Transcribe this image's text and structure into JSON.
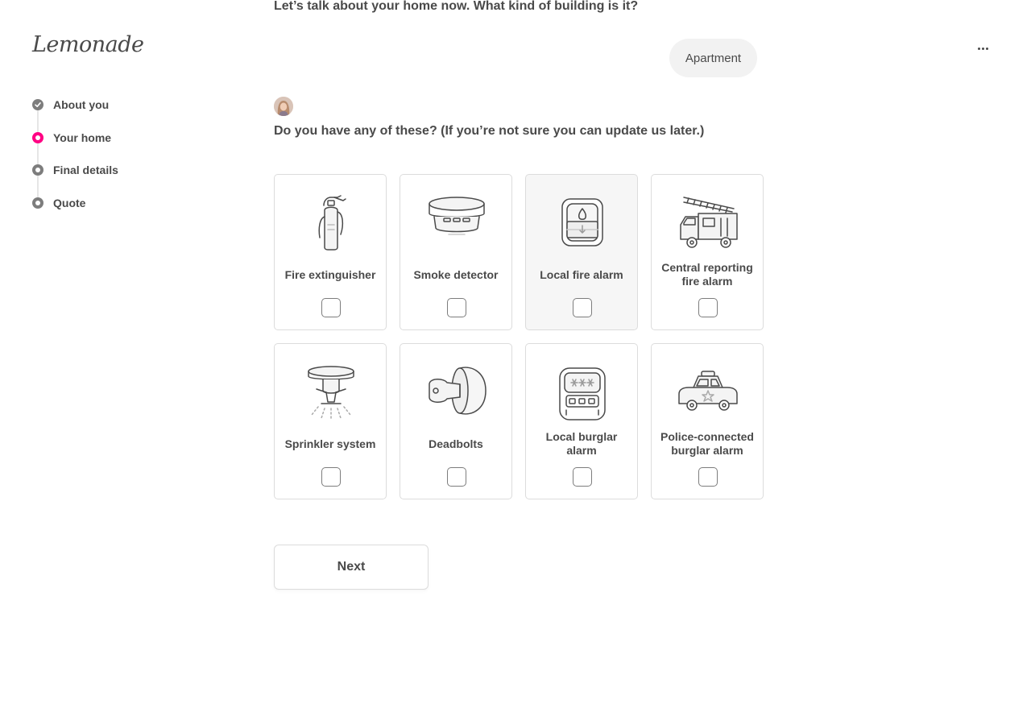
{
  "brand": {
    "logo_text": "Lemonade"
  },
  "progress": {
    "steps": [
      {
        "label": "About you",
        "state": "done"
      },
      {
        "label": "Your home",
        "state": "active"
      },
      {
        "label": "Final details",
        "state": "pending"
      },
      {
        "label": "Quote",
        "state": "pending"
      }
    ],
    "active_color": "#ff0083"
  },
  "conversation": {
    "previous_question": "Let’s talk about your home now. What kind of building is it?",
    "previous_answer": "Apartment",
    "question": "Do you have any of these? (If you’re not sure you can update us later.)"
  },
  "options": [
    {
      "label": "Fire extinguisher",
      "icon": "fire-extinguisher-icon",
      "checked": false
    },
    {
      "label": "Smoke detector",
      "icon": "smoke-detector-icon",
      "checked": false
    },
    {
      "label": "Local fire alarm",
      "icon": "fire-alarm-icon",
      "checked": false
    },
    {
      "label": "Central reporting fire alarm",
      "icon": "fire-truck-icon",
      "checked": false
    },
    {
      "label": "Sprinkler system",
      "icon": "sprinkler-icon",
      "checked": false
    },
    {
      "label": "Deadbolts",
      "icon": "deadbolt-icon",
      "checked": false
    },
    {
      "label": "Local burglar alarm",
      "icon": "burglar-alarm-keypad-icon",
      "checked": false
    },
    {
      "label": "Police-connected burglar alarm",
      "icon": "police-car-icon",
      "checked": false
    }
  ],
  "actions": {
    "next_label": "Next"
  }
}
